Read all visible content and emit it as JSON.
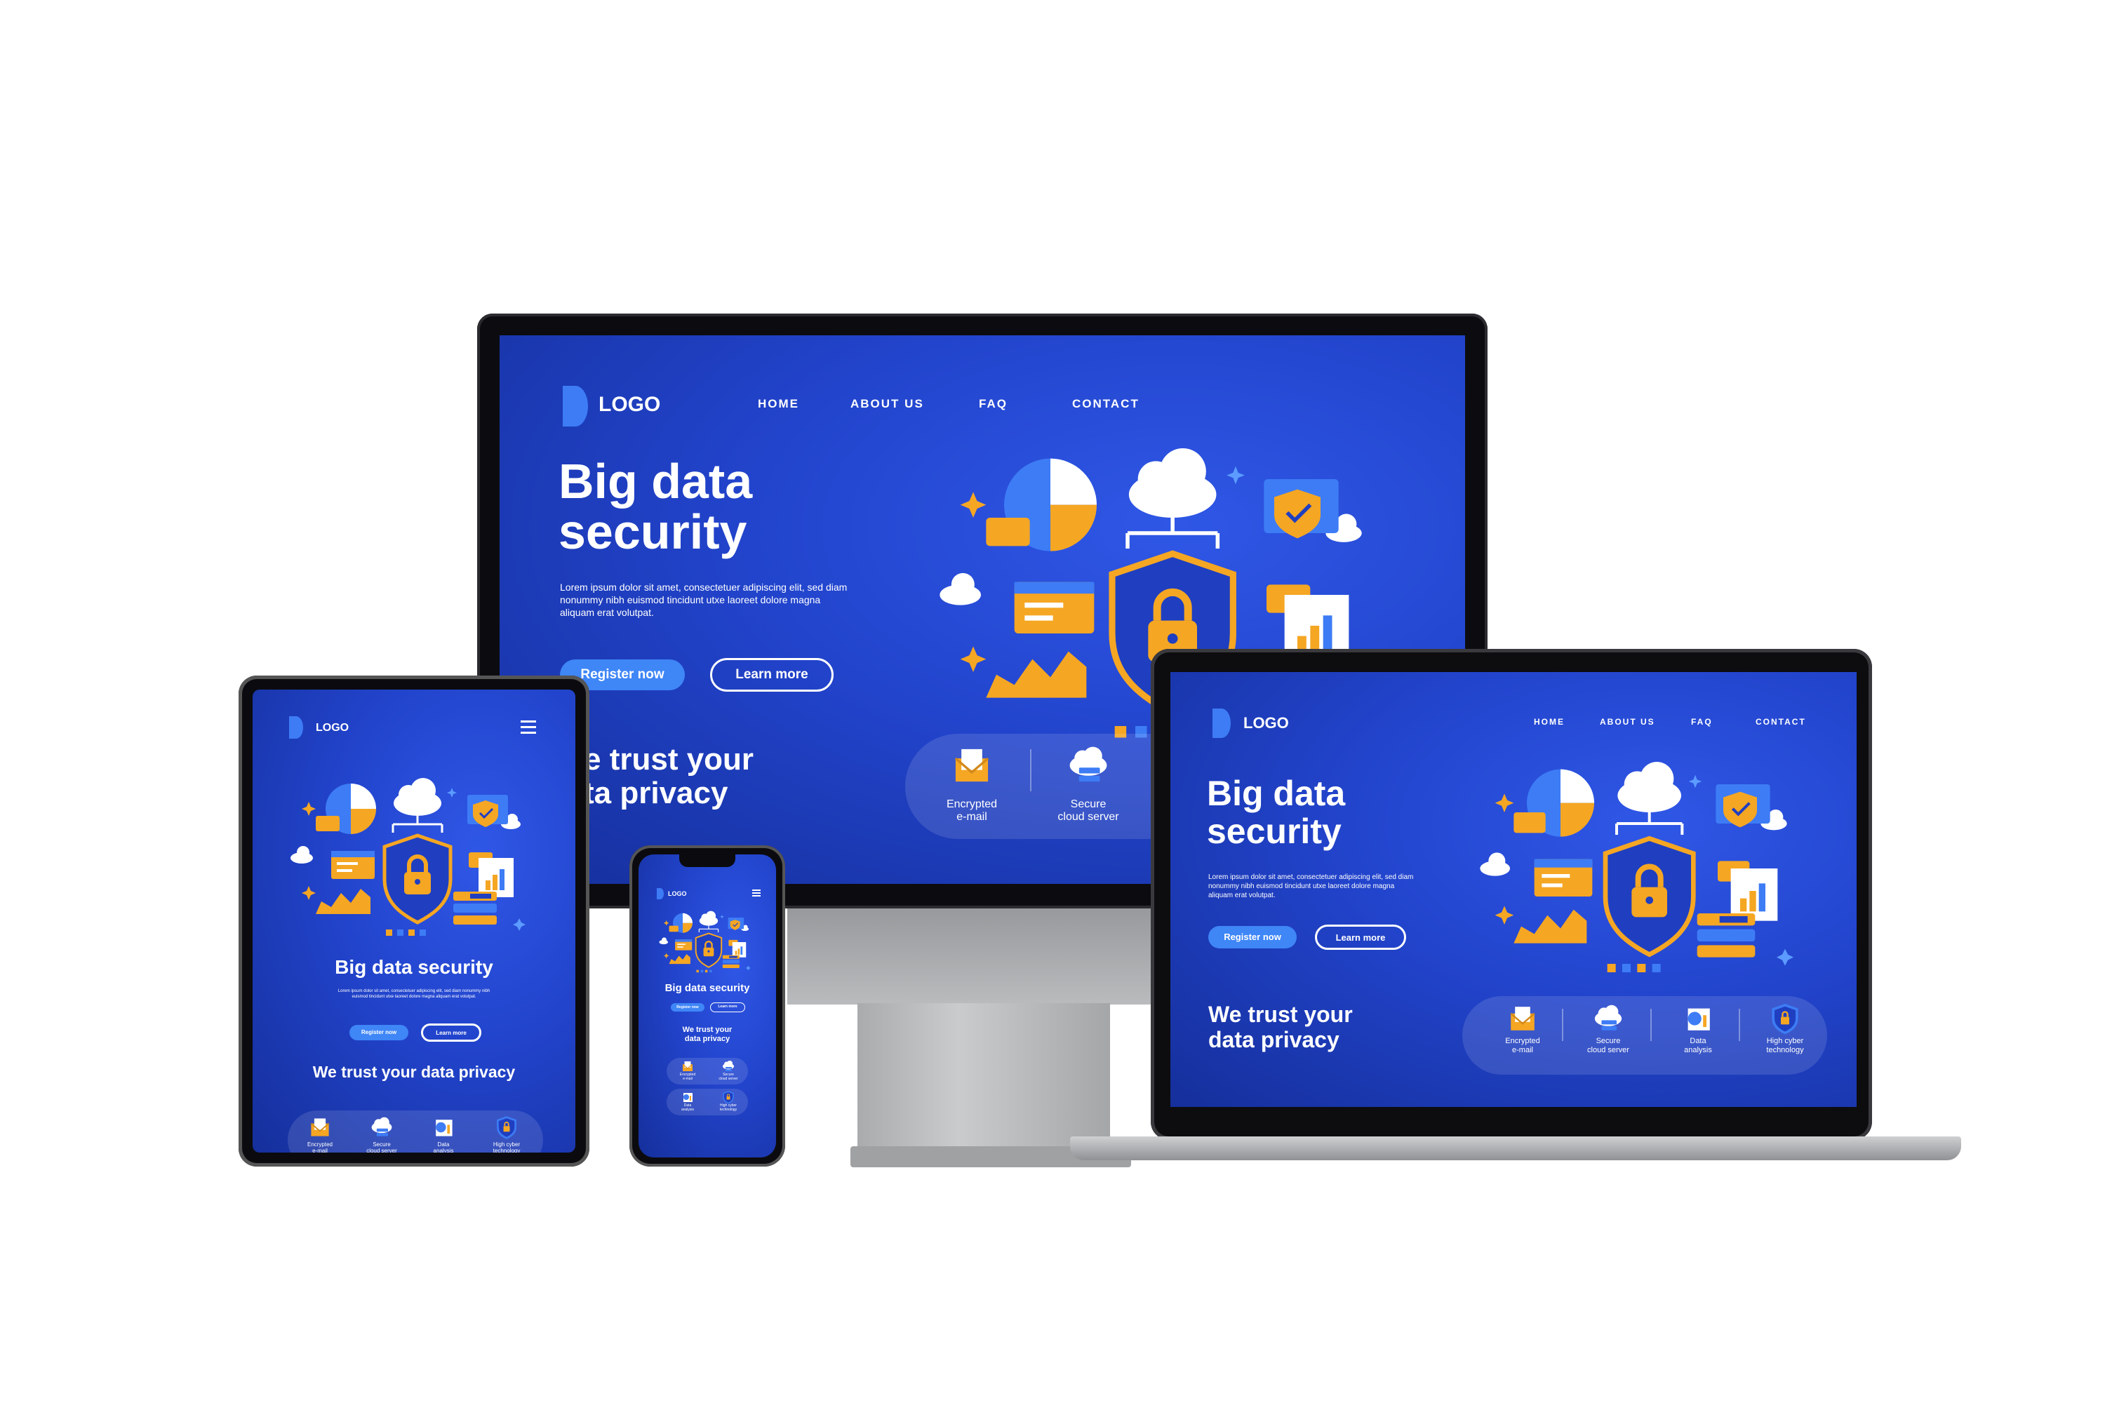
{
  "brand": {
    "logo_letter": "D",
    "logo_text": "LOGO"
  },
  "nav": {
    "home": "HOME",
    "about": "ABOUT US",
    "faq": "FAQ",
    "contact": "CONTACT"
  },
  "hero": {
    "title_line1": "Big data",
    "title_line2": "security",
    "title_single": "Big data security",
    "body": "Lorem ipsum dolor sit amet, consectetuer adipiscing elit, sed diam nonummy nibh euismod tincidunt utxe laoreet dolore magna aliquam erat volutpat."
  },
  "buttons": {
    "register": "Register now",
    "learn": "Learn more"
  },
  "trust": {
    "line1": "We trust your",
    "line2": "data privacy",
    "single": "We trust your data privacy",
    "monitor_line1": "e trust your",
    "monitor_line2": "ta privacy"
  },
  "features": [
    {
      "icon": "email-icon",
      "line1": "Encrypted",
      "line2": "e-mail"
    },
    {
      "icon": "cloud-server-icon",
      "line1": "Secure",
      "line2": "cloud server"
    },
    {
      "icon": "data-analysis-icon",
      "line1": "Data",
      "line2": "analysis"
    },
    {
      "icon": "shield-lock-icon",
      "line1": "High cyber",
      "line2": "technology"
    }
  ],
  "menu_icon": "hamburger-icon",
  "colors": {
    "primary": "#2244cc",
    "accent": "#f5a623",
    "button": "#3f86f7",
    "logo": "#3d7cf5"
  }
}
